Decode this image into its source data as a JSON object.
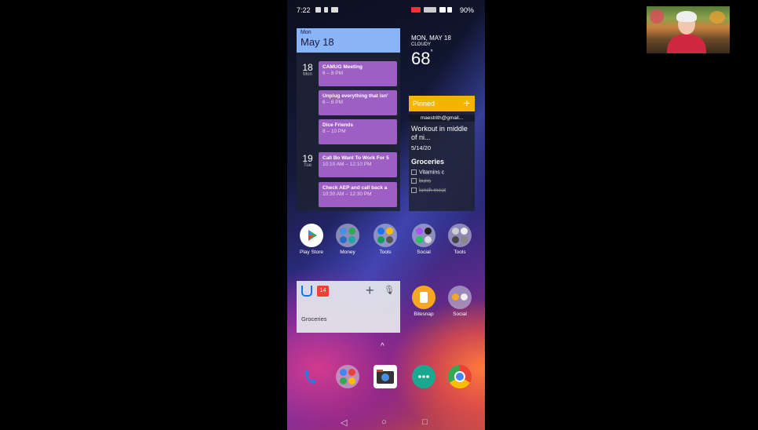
{
  "status": {
    "time": "7:22",
    "battery": "90%"
  },
  "calendar": {
    "dow": "Mon",
    "month_day": "May 18",
    "days": [
      {
        "num": "18",
        "dow": "Mon"
      },
      {
        "num": "19",
        "dow": "Tue"
      }
    ],
    "events": [
      {
        "title": "CAMUG Meeting",
        "time": "6 – 8 PM"
      },
      {
        "title": "Unplug everything that isn'",
        "time": "6 – 8 PM"
      },
      {
        "title": "Dice Friends",
        "time": "8 – 10 PM"
      },
      {
        "title": "Call Bo Want To Work For 5",
        "time": "10:10 AM – 12:10 PM"
      },
      {
        "title": "Check AEP and call back a",
        "time": "10:30 AM – 12:30 PM"
      }
    ],
    "event_color": "#9d5fc4",
    "header_color": "#8ab4f8"
  },
  "weather": {
    "date": "MON, MAY 18",
    "condition": "CLOUDY",
    "temp": "68",
    "deg": "°"
  },
  "keep": {
    "header": "Pinned",
    "plus": "+",
    "account": "maestrith@gmail...",
    "note1": {
      "title": "Workout in middle of ni...",
      "date": "5/14/20"
    },
    "note2": {
      "title": "Groceries",
      "items": [
        {
          "text": "Vitamins c",
          "done": false
        },
        {
          "text": "buns",
          "done": true
        },
        {
          "text": "lunch meat",
          "done": true
        }
      ]
    },
    "accent": "#f6b400"
  },
  "apps_row1": [
    {
      "label": "Play Store",
      "icon": "play-store-icon"
    },
    {
      "label": "Money",
      "icon": "folder-icon"
    },
    {
      "label": "Tools",
      "icon": "folder-icon"
    },
    {
      "label": "Social",
      "icon": "folder-icon"
    },
    {
      "label": "Tools",
      "icon": "folder-icon"
    }
  ],
  "apps_row2": [
    {
      "label": "Bitesnap",
      "icon": "bitesnap-icon"
    },
    {
      "label": "Social",
      "icon": "folder-icon"
    }
  ],
  "search_widget": {
    "badge": "14",
    "plus": "+",
    "label": "Groceries"
  },
  "nav": {
    "back": "◁",
    "home": "○",
    "recents": "□"
  }
}
